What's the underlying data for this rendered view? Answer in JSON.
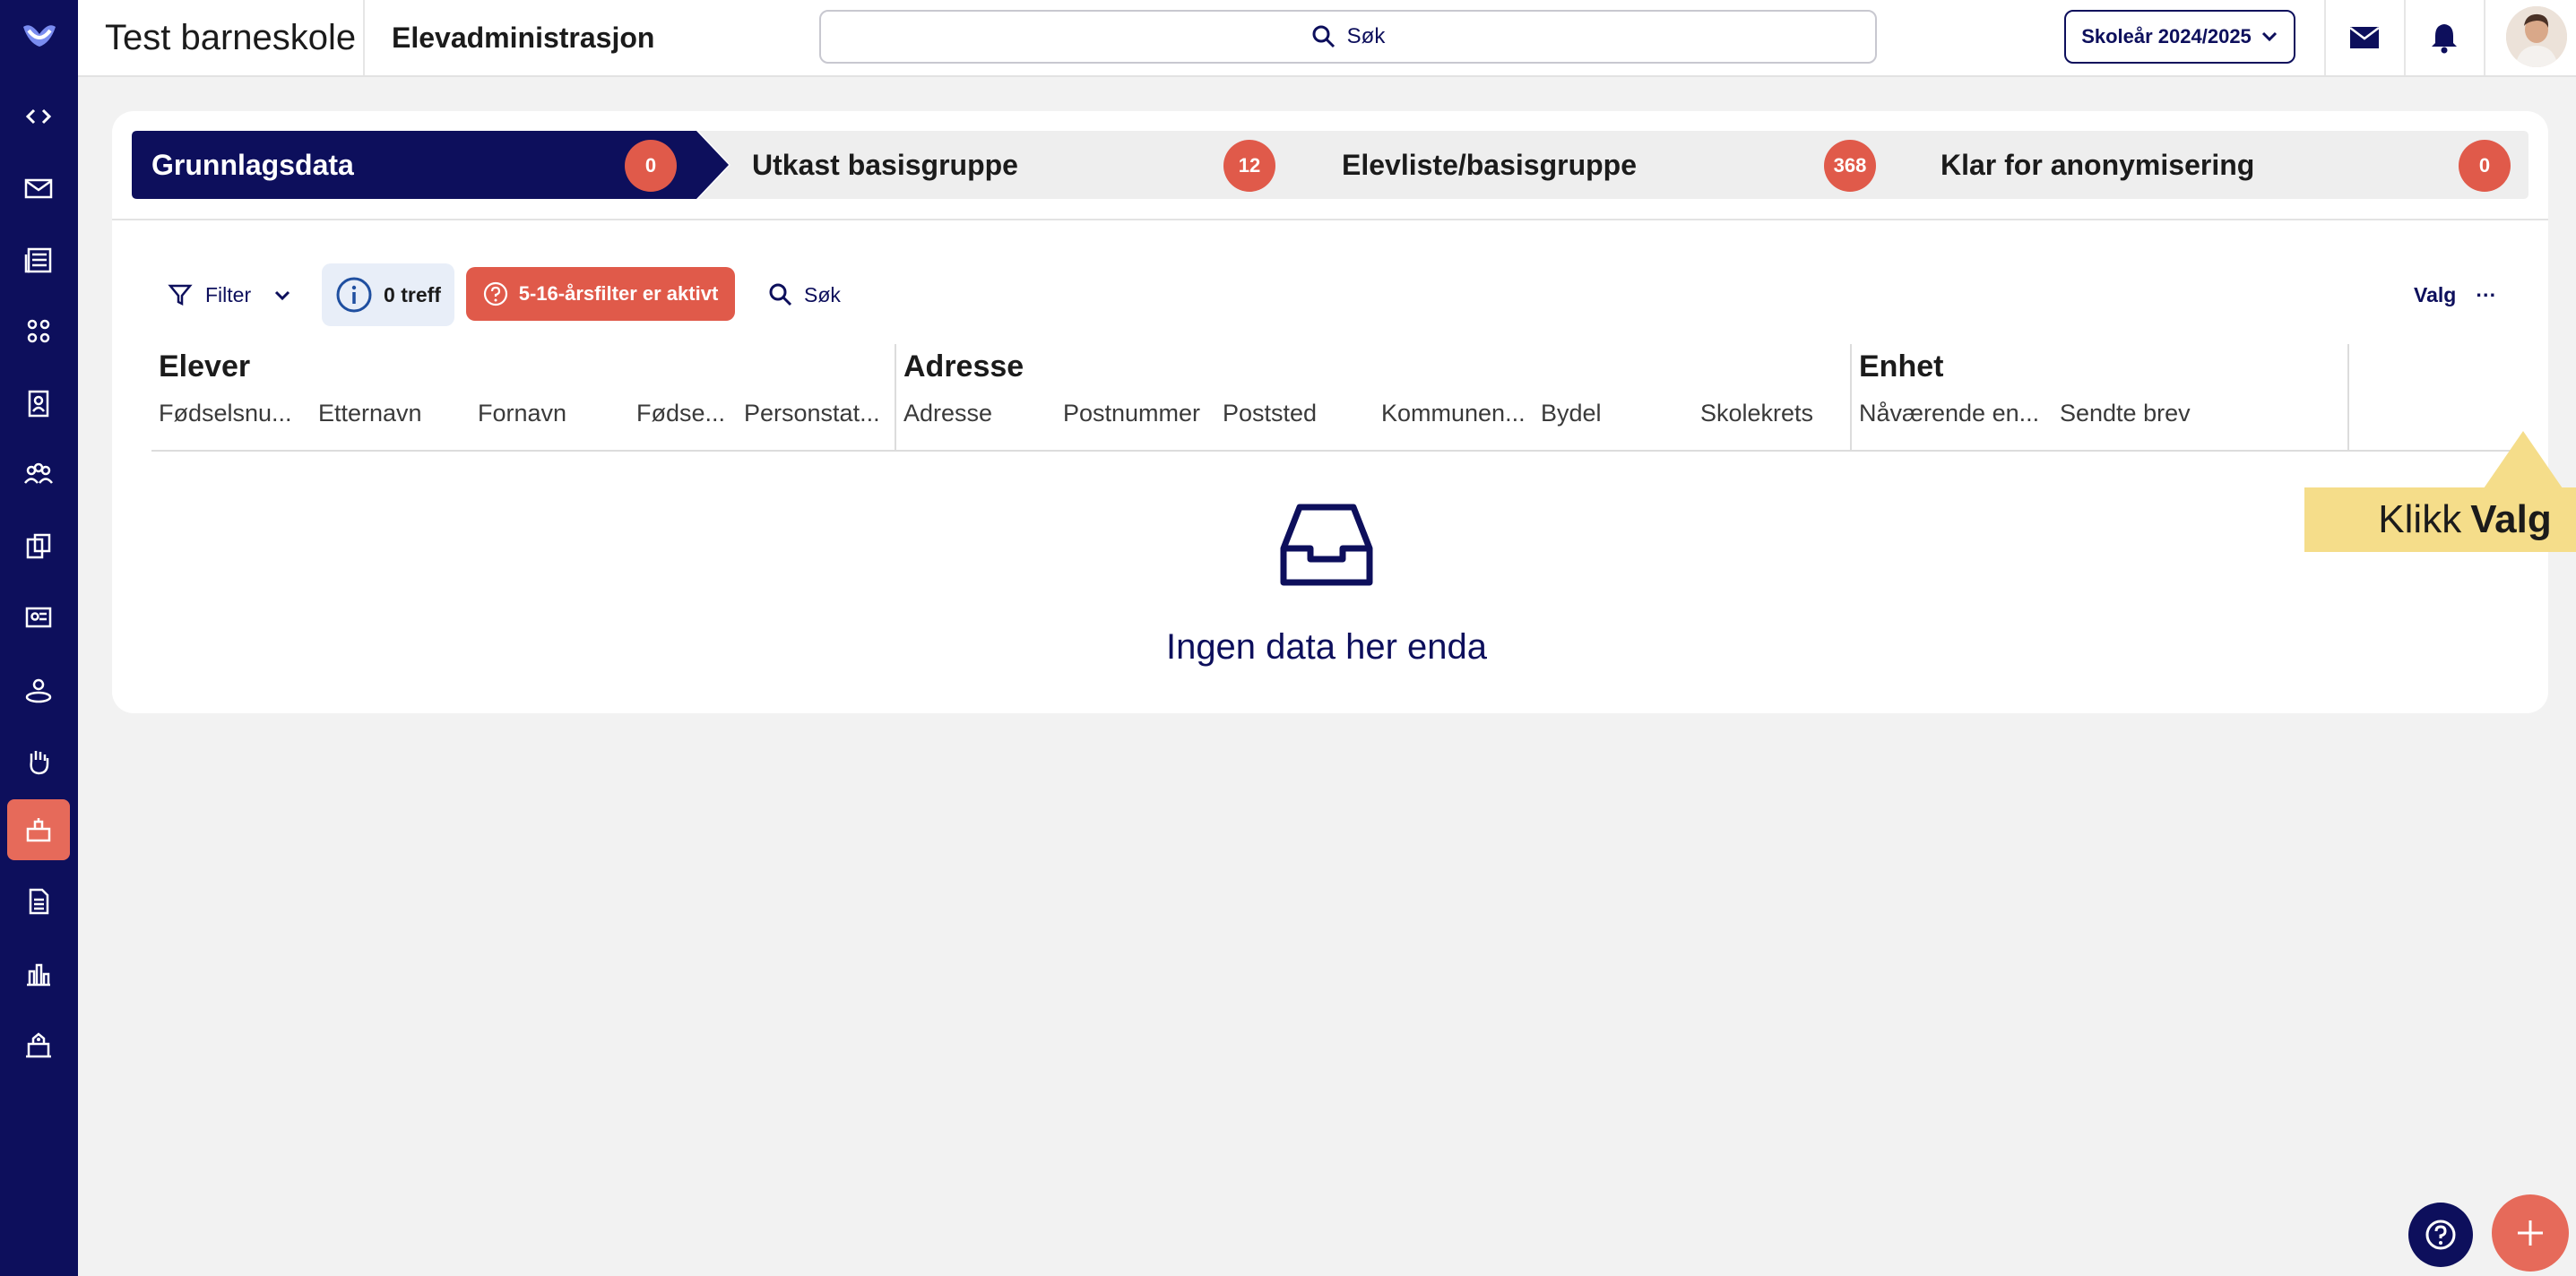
{
  "header": {
    "school_name": "Test barneskole",
    "module_name": "Elevadministrasjon",
    "search_label": "Søk",
    "school_year": "Skoleår 2024/2025"
  },
  "icons": {
    "rail": [
      "code-icon",
      "mail-icon",
      "news-icon",
      "groups-icon",
      "badge-icon",
      "people-icon",
      "puzzle-icon",
      "chalkboard-icon",
      "user-circle-icon",
      "hand-icon",
      "student-admin-icon",
      "document-icon",
      "bar-chart-icon",
      "school-icon"
    ],
    "top": [
      "mail-icon",
      "bell-icon",
      "avatar"
    ]
  },
  "steps": [
    {
      "label": "Grunnlagsdata",
      "count": "0",
      "active": true
    },
    {
      "label": "Utkast basisgruppe",
      "count": "12",
      "active": false
    },
    {
      "label": "Elevliste/basisgruppe",
      "count": "368",
      "active": false
    },
    {
      "label": "Klar for anonymisering",
      "count": "0",
      "active": false
    }
  ],
  "toolbar": {
    "filter_label": "Filter",
    "hits_label": "0 treff",
    "age_filter_label": "5-16-årsfilter er aktivt",
    "search_label": "Søk",
    "options_label": "Valg",
    "more_label": "···"
  },
  "table": {
    "groups": [
      {
        "title": "Elever",
        "columns": [
          "Fødselsnu...",
          "Etternavn",
          "Fornavn",
          "Fødse...",
          "Personstat..."
        ]
      },
      {
        "title": "Adresse",
        "columns": [
          "Adresse",
          "Postnummer",
          "Poststed",
          "Kommunen...",
          "Bydel",
          "Skolekrets"
        ]
      },
      {
        "title": "Enhet",
        "columns": [
          "Nåværende en...",
          "Sendte brev"
        ]
      }
    ],
    "empty_text": "Ingen data her enda"
  },
  "tooltip": {
    "prefix": "Klikk",
    "emphasis": "Valg"
  },
  "colors": {
    "navy": "#0d0f5c",
    "accent": "#e05a4a",
    "tooltip": "#f5dd8a"
  }
}
